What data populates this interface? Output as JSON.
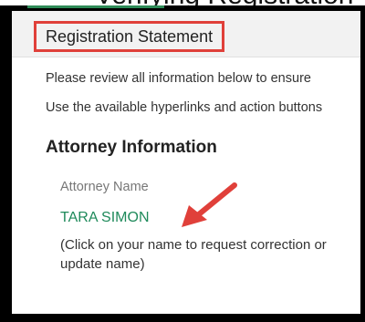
{
  "page": {
    "header_title": "Registration Statement",
    "instruction_1": "Please review all information below to ensure",
    "instruction_2": "Use the available hyperlinks and action buttons",
    "top_crop_text": "Verifying Registration"
  },
  "attorney": {
    "section_heading": "Attorney Information",
    "field_label": "Attorney Name",
    "name": "TARA SIMON",
    "note": "(Click on your name to request correction or update name)"
  },
  "colors": {
    "accent_green": "#1f8a5b",
    "highlight_red": "#e0403a"
  }
}
